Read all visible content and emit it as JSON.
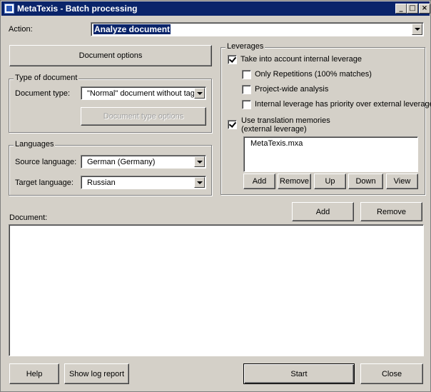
{
  "window": {
    "title": "MetaTexis - Batch processing"
  },
  "action": {
    "label": "Action:",
    "value": "Analyze document"
  },
  "document_options": {
    "label": "Document options"
  },
  "type_of_document": {
    "legend": "Type of document",
    "doc_type_label": "Document type:",
    "doc_type_value": "\"Normal\" document without tags",
    "doc_type_options_label": "Document type options"
  },
  "languages": {
    "legend": "Languages",
    "source_label": "Source language:",
    "source_value": "German (Germany)",
    "target_label": "Target language:",
    "target_value": "Russian"
  },
  "leverages": {
    "legend": "Leverages",
    "internal": {
      "label": "Take into account internal leverage",
      "checked": true
    },
    "only_repetitions": {
      "label": "Only Repetitions (100% matches)",
      "checked": false
    },
    "project_wide": {
      "label": "Project-wide analysis",
      "checked": false
    },
    "internal_priority": {
      "label": "Internal leverage has priority over external leverage",
      "checked": false
    },
    "use_tm": {
      "label_line1": "Use translation memories",
      "label_line2": "(external leverage)",
      "checked": true
    },
    "tm_list": [
      "MetaTexis.mxa"
    ],
    "buttons": {
      "add": "Add",
      "remove": "Remove",
      "up": "Up",
      "down": "Down",
      "view": "View"
    }
  },
  "document": {
    "label": "Document:",
    "add": "Add",
    "remove": "Remove"
  },
  "footer": {
    "help": "Help",
    "show_log": "Show log report",
    "start": "Start",
    "close": "Close"
  }
}
